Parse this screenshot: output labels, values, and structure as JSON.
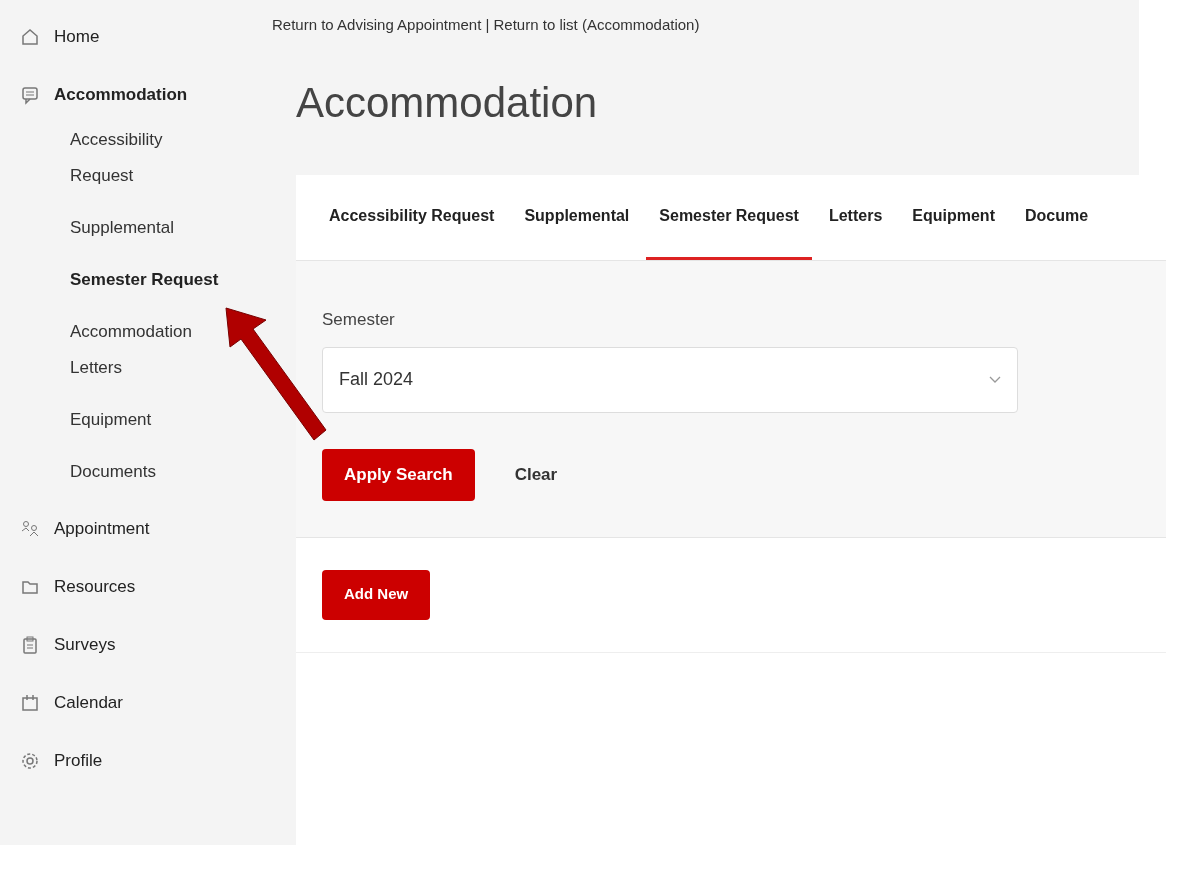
{
  "sidebar": {
    "items": [
      {
        "label": "Home",
        "expanded": false
      },
      {
        "label": "Accommodation",
        "expanded": true,
        "children": [
          {
            "label": "Accessibility Request",
            "selected": false
          },
          {
            "label": "Supplemental",
            "selected": false
          },
          {
            "label": "Semester Request",
            "selected": true
          },
          {
            "label": "Accommodation Letters",
            "selected": false
          },
          {
            "label": "Equipment",
            "selected": false
          },
          {
            "label": "Documents",
            "selected": false
          }
        ]
      },
      {
        "label": "Appointment",
        "expanded": false
      },
      {
        "label": "Resources",
        "expanded": false
      },
      {
        "label": "Surveys",
        "expanded": false
      },
      {
        "label": "Calendar",
        "expanded": false
      },
      {
        "label": "Profile",
        "expanded": false
      }
    ]
  },
  "breadcrumb": "Return to Advising Appointment | Return to list (Accommodation)",
  "title": "Accommodation",
  "tabs": [
    {
      "label": "Accessibility Request",
      "selected": false
    },
    {
      "label": "Supplemental",
      "selected": false
    },
    {
      "label": "Semester Request",
      "selected": true
    },
    {
      "label": "Letters",
      "selected": false
    },
    {
      "label": "Equipment",
      "selected": false
    },
    {
      "label": "Docume",
      "selected": false
    }
  ],
  "filter": {
    "label": "Semester",
    "value": "Fall 2024",
    "apply_button": "Apply Search",
    "clear_button": "Clear"
  },
  "add_button": "Add New"
}
